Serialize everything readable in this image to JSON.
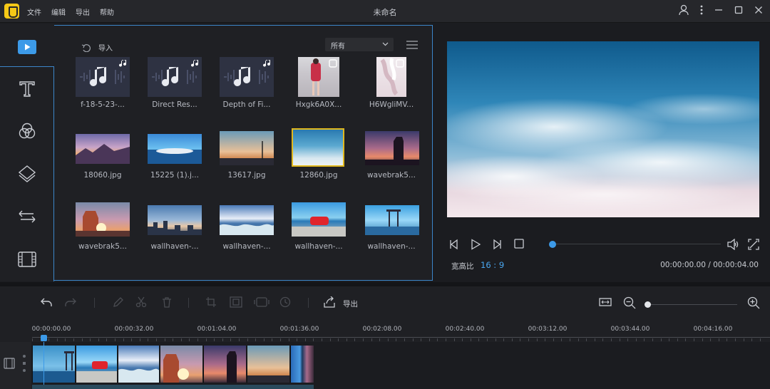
{
  "app": {
    "title": "未命名",
    "menu": [
      "文件",
      "编辑",
      "导出",
      "帮助"
    ]
  },
  "media": {
    "import_label": "导入",
    "filter_value": "所有",
    "items": [
      {
        "label": "f-18-5-23-...",
        "kind": "audio"
      },
      {
        "label": "Direct Res...",
        "kind": "audio"
      },
      {
        "label": "Depth of Fi...",
        "kind": "audio"
      },
      {
        "label": "Hxgk6A0X...",
        "kind": "video"
      },
      {
        "label": "H6WgliMV...",
        "kind": "video"
      },
      {
        "label": "18060.jpg",
        "kind": "image"
      },
      {
        "label": "15225 (1).j...",
        "kind": "image"
      },
      {
        "label": "13617.jpg",
        "kind": "image"
      },
      {
        "label": "12860.jpg",
        "kind": "image",
        "selected": true
      },
      {
        "label": "wavebrak5...",
        "kind": "image"
      },
      {
        "label": "wavebrak5...",
        "kind": "image"
      },
      {
        "label": "wallhaven-...",
        "kind": "image"
      },
      {
        "label": "wallhaven-...",
        "kind": "image"
      },
      {
        "label": "wallhaven-...",
        "kind": "image"
      },
      {
        "label": "wallhaven-...",
        "kind": "image"
      }
    ]
  },
  "preview": {
    "aspect_label": "宽高比",
    "aspect_value": "16 : 9",
    "timecode": "00:00:00.00 / 00:00:04.00",
    "progress": 0
  },
  "timeline": {
    "export_label": "导出",
    "ruler_labels": [
      "00:00:00.00",
      "00:00:32.00",
      "00:01:04.00",
      "00:01:36.00",
      "00:02:08.00",
      "00:02:40.00",
      "00:03:12.00",
      "00:03:44.00",
      "00:04:16.00"
    ],
    "zoom_level": 0
  },
  "colors": {
    "accent": "#3c9ae8",
    "selection": "#e0b81e",
    "brand": "#f6c917"
  }
}
